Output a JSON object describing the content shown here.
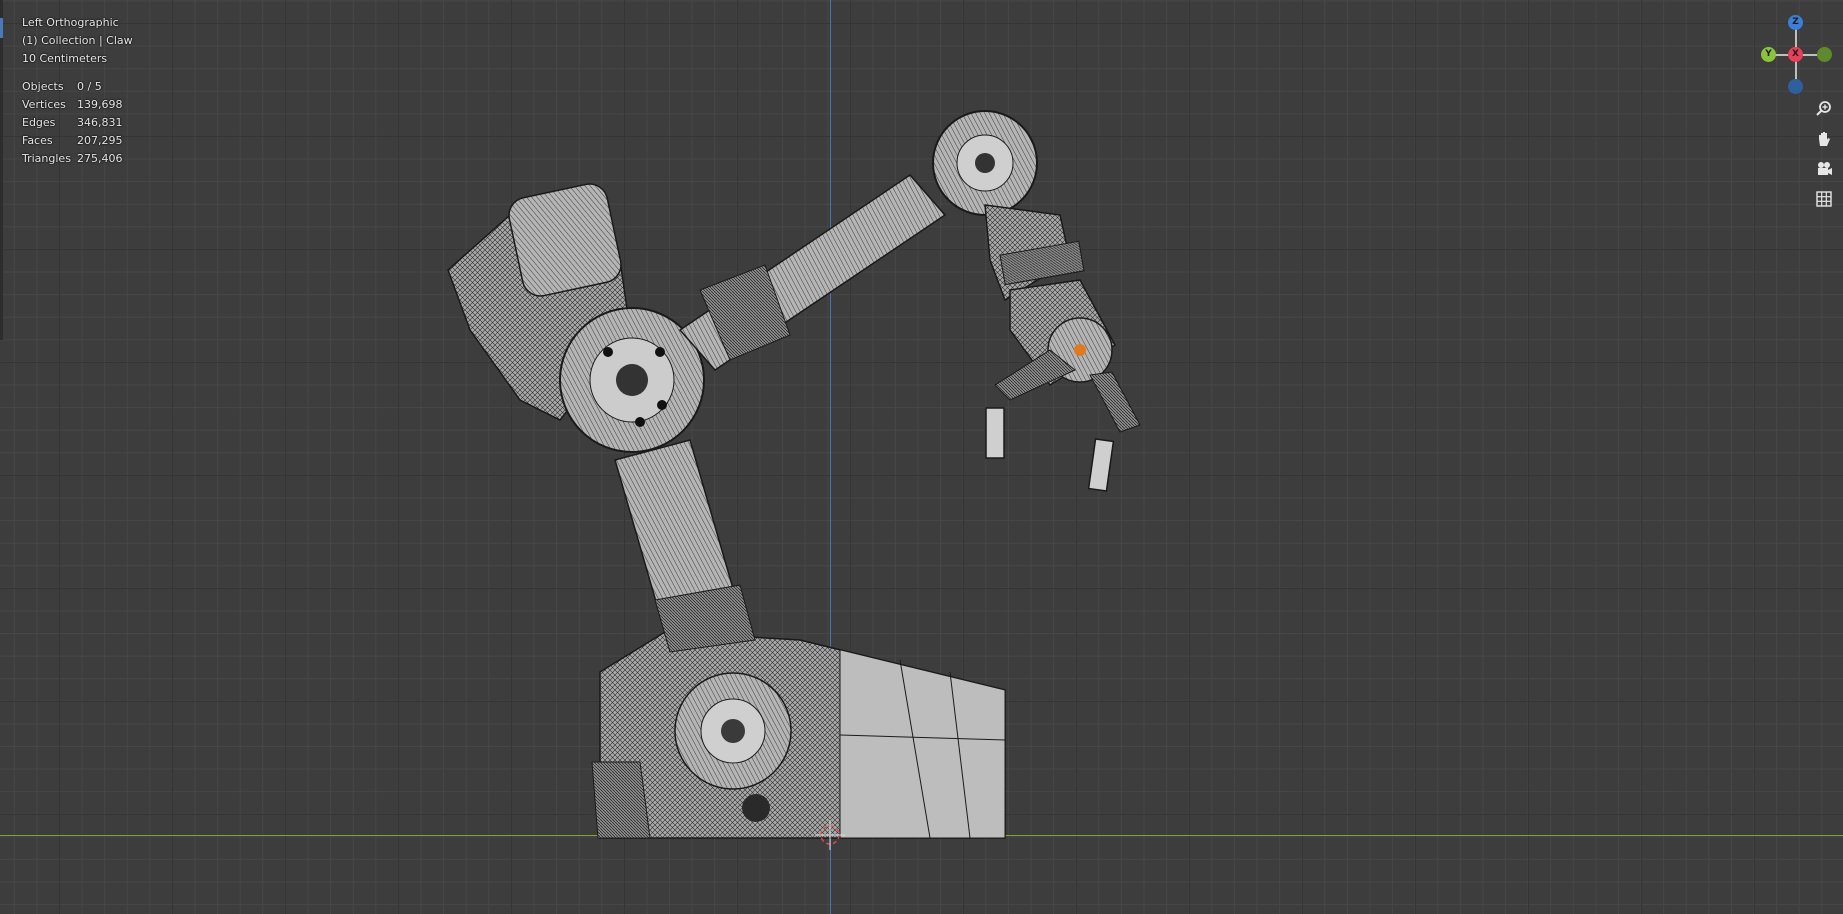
{
  "viewport": {
    "view_name": "Left Orthographic",
    "collection": "(1) Collection | Claw",
    "grid_scale": "10 Centimeters"
  },
  "stats": {
    "rows": [
      {
        "label": "Objects",
        "value": "0 / 5"
      },
      {
        "label": "Vertices",
        "value": "139,698"
      },
      {
        "label": "Edges",
        "value": "346,831"
      },
      {
        "label": "Faces",
        "value": "207,295"
      },
      {
        "label": "Triangles",
        "value": "275,406"
      }
    ]
  },
  "gizmo": {
    "z_label": "Z",
    "y_label": "Y",
    "x_label": "X",
    "colors": {
      "z": "#3b7fd8",
      "y": "#8bc43a",
      "x": "#e8405a",
      "neg": "#2f5f9e"
    }
  },
  "nav_buttons": [
    {
      "icon": "zoom-icon"
    },
    {
      "icon": "hand-pan-icon"
    },
    {
      "icon": "camera-icon"
    },
    {
      "icon": "grid-icon"
    }
  ],
  "colors": {
    "background": "#3d3d3d",
    "mesh": "#b8b8b8",
    "wire": "#1e1e1e"
  }
}
